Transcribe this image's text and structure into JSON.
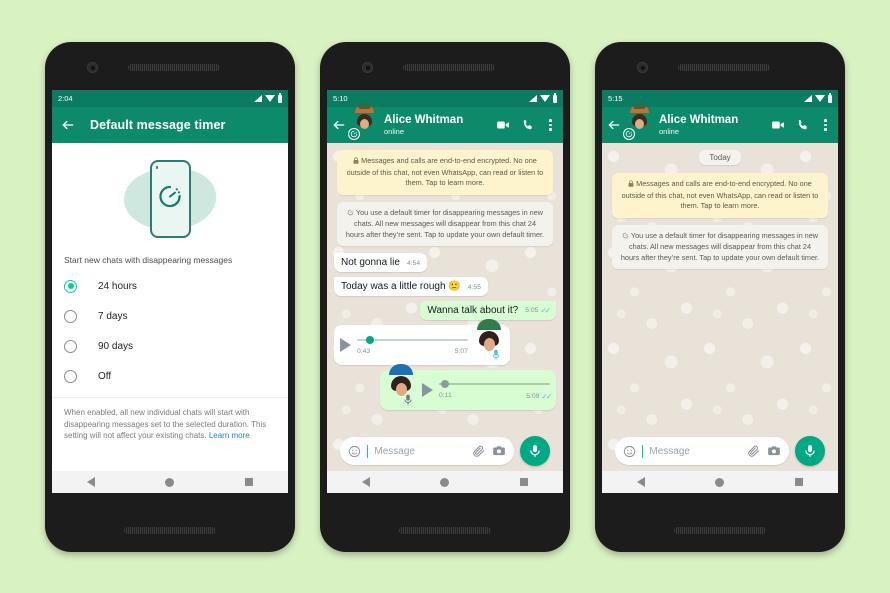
{
  "background_color": "#d9f2c2",
  "brand": {
    "header_green": "#0d8a6a",
    "status_green": "#0b7b62",
    "accent": "#06cf9c",
    "bubble_out": "#d9fdd3",
    "link": "#2b7bd6"
  },
  "phone1": {
    "status": {
      "time": "2:04",
      "icons": [
        "signal-icon",
        "wifi-icon",
        "battery-icon"
      ]
    },
    "appbar": {
      "back": "back-arrow-icon",
      "title": "Default message timer"
    },
    "illustration": {
      "name": "phone-timer-illustration"
    },
    "section_label": "Start new chats with disappearing messages",
    "options": [
      {
        "label": "24 hours",
        "selected": true
      },
      {
        "label": "7 days",
        "selected": false
      },
      {
        "label": "90 days",
        "selected": false
      },
      {
        "label": "Off",
        "selected": false
      }
    ],
    "helper_text": "When enabled, all new individual chats will start with disappearing messages set to the selected duration. This setting will not affect your existing chats. ",
    "helper_link": "Learn more",
    "nav": [
      "back-nav-button",
      "home-nav-button",
      "recents-nav-button"
    ]
  },
  "phone2": {
    "status": {
      "time": "5:10"
    },
    "appbar": {
      "contact_name": "Alice Whitman",
      "presence": "online",
      "actions": [
        "video-call-icon",
        "voice-call-icon",
        "overflow-menu-icon"
      ]
    },
    "system_messages": [
      {
        "type": "e2e",
        "icon": "lock-icon",
        "text": "Messages and calls are end-to-end encrypted. No one outside of this chat, not even WhatsApp, can read or listen to them. Tap to learn more."
      },
      {
        "type": "timer",
        "icon": "timer-icon",
        "text": "You use a default timer for disappearing messages in new chats. All new messages will disappear from this chat 24 hours after they’re sent. Tap to update your own default timer."
      }
    ],
    "messages": [
      {
        "dir": "in",
        "text": "Not gonna lie",
        "time": "4:54"
      },
      {
        "dir": "in",
        "text": "Today was a little rough 🙂",
        "time": "4:55"
      },
      {
        "dir": "out",
        "text": "Wanna talk about it?",
        "time": "5:05",
        "ticks": "✓✓"
      }
    ],
    "voice_messages": [
      {
        "dir": "in",
        "position": "0:43",
        "duration": "5:07",
        "time": "",
        "avatar": "contact-avatar"
      },
      {
        "dir": "out",
        "position": "0:11",
        "duration": "5:09",
        "time": "",
        "ticks": "✓✓",
        "avatar": "self-avatar"
      }
    ],
    "composer": {
      "emoji": "emoji-icon",
      "placeholder": "Message",
      "attach": "attachment-icon",
      "camera": "camera-icon",
      "mic": "microphone-icon"
    }
  },
  "phone3": {
    "status": {
      "time": "5:15"
    },
    "appbar": {
      "contact_name": "Alice Whitman",
      "presence": "online"
    },
    "day_chip": "Today",
    "system_messages": [
      {
        "type": "e2e",
        "text": "Messages and calls are end-to-end encrypted. No one outside of this chat, not even WhatsApp, can read or listen to them. Tap to learn more."
      },
      {
        "type": "timer",
        "text": "You use a default timer for disappearing messages in new chats. All new messages will disappear from this chat 24 hours after they’re sent. Tap to update your own default timer."
      }
    ],
    "composer": {
      "placeholder": "Message"
    }
  }
}
